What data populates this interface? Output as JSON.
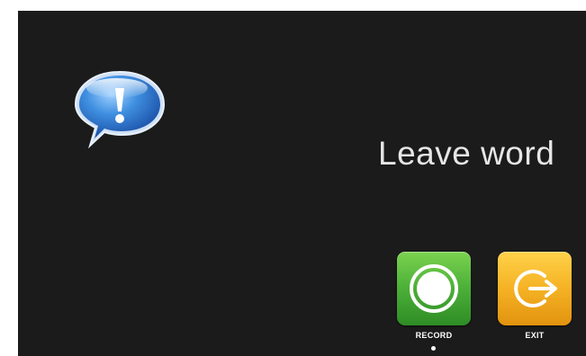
{
  "screen": {
    "title": "Leave word"
  },
  "icons": {
    "message": "speech-bubble-exclamation-icon",
    "record": "record-circle-icon",
    "exit": "exit-arrow-icon"
  },
  "buttons": {
    "record_label": "RECORD",
    "exit_label": "EXIT",
    "selected": "RECORD"
  },
  "colors": {
    "background": "#1b1b1b",
    "record_tile": "#4fb33a",
    "exit_tile": "#f5b224",
    "bubble": "#2f7fd6"
  }
}
